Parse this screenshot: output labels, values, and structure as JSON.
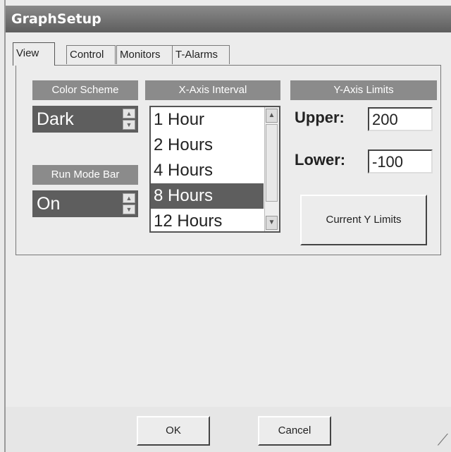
{
  "window": {
    "title": "GraphSetup"
  },
  "tabs": [
    {
      "label": "View"
    },
    {
      "label": "Control"
    },
    {
      "label": "Monitors"
    },
    {
      "label": "T-Alarms"
    }
  ],
  "color_scheme": {
    "header": "Color Scheme",
    "value": "Dark"
  },
  "run_mode_bar": {
    "header": "Run Mode Bar",
    "value": "On"
  },
  "x_axis": {
    "header": "X-Axis Interval",
    "items": [
      "1 Hour",
      "2 Hours",
      "4 Hours",
      "8 Hours",
      "12 Hours"
    ],
    "selected": "8 Hours"
  },
  "y_axis": {
    "header": "Y-Axis Limits",
    "upper_label": "Upper:",
    "upper_value": "200",
    "lower_label": "Lower:",
    "lower_value": "-100",
    "current_button": "Current Y Limits"
  },
  "buttons": {
    "ok": "OK",
    "cancel": "Cancel"
  }
}
